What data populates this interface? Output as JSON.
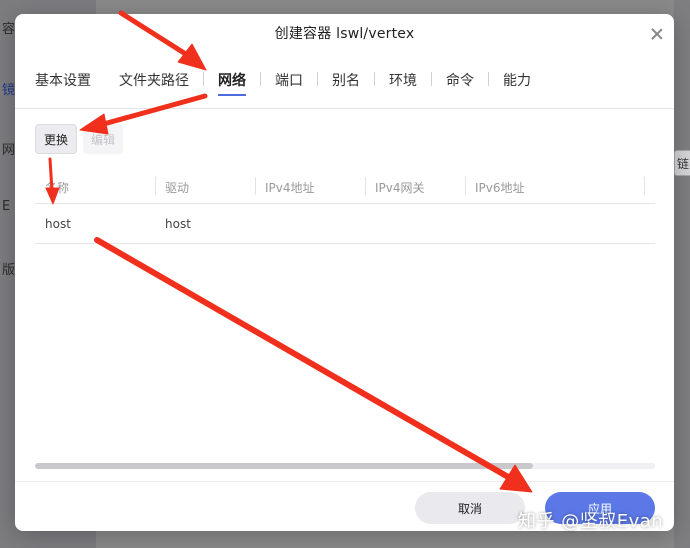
{
  "background": {
    "left_items": [
      "容器",
      "镜",
      "网",
      "E",
      "版本"
    ],
    "right_chip": "链"
  },
  "dialog": {
    "title": "创建容器 lswl/vertex",
    "close_icon": "close-icon"
  },
  "tabs": [
    "基本设置",
    "文件夹路径",
    "网络",
    "端口",
    "别名",
    "环境",
    "命令",
    "能力"
  ],
  "active_tab": "网络",
  "toolbar": {
    "change_label": "更换",
    "edit_label": "编辑"
  },
  "table": {
    "columns": [
      "名称",
      "驱动",
      "IPv4地址",
      "IPv4网关",
      "IPv6地址"
    ],
    "rows": [
      [
        "host",
        "host",
        "",
        "",
        ""
      ]
    ]
  },
  "footer": {
    "cancel_label": "取消",
    "apply_label": "应用"
  },
  "watermark": "知乎 @坚叔Evan",
  "colors": {
    "accent": "#5b78e6",
    "annotation_arrow": "#f0301c"
  }
}
